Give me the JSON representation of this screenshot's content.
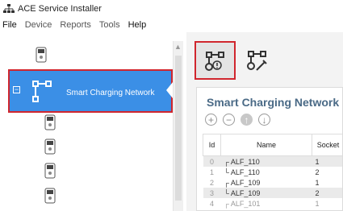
{
  "window": {
    "title": "ACE Service Installer"
  },
  "menu": {
    "items": [
      "File",
      "Device",
      "Reports",
      "Tools",
      "Help"
    ]
  },
  "tree": {
    "selected_label": "Smart Charging Network"
  },
  "panel": {
    "title": "Smart Charging Network - C",
    "columns": [
      "Id",
      "Name",
      "Socket"
    ],
    "rows": [
      {
        "id": "0",
        "name": "┌ ALF_110",
        "socket": "1"
      },
      {
        "id": "1",
        "name": "└ ALF_110",
        "socket": "2"
      },
      {
        "id": "2",
        "name": "┌ ALF_109",
        "socket": "1"
      },
      {
        "id": "3",
        "name": "└ ALF_109",
        "socket": "2"
      },
      {
        "id": "4",
        "name": "┌ ALF_101",
        "socket": "1"
      }
    ]
  },
  "colors": {
    "selection": "#3b8fe6",
    "highlight_border": "#d0262e",
    "title": "#4a6a86"
  }
}
